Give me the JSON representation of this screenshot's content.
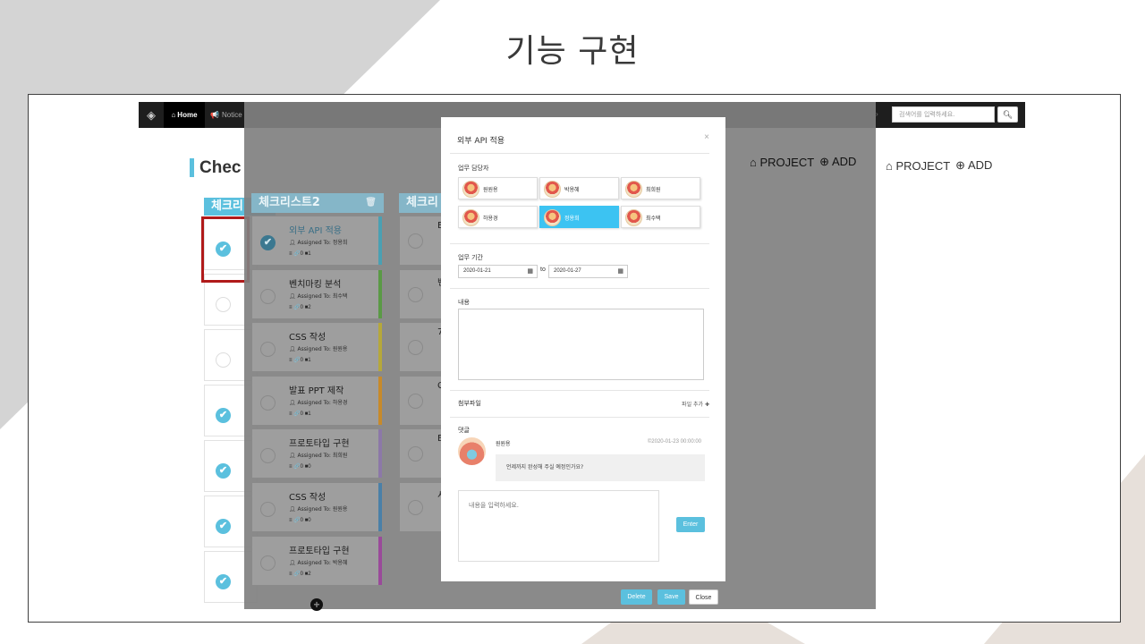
{
  "slide": {
    "title": "기능 구현"
  },
  "nav": {
    "home": "Home",
    "notice": "Notice",
    "search_placeholder": "검색어를 입력하세요."
  },
  "page": {
    "title": "Chec",
    "col1_header": "체크리",
    "project": "PROJECT",
    "add": "ADD",
    "bg_cards": [
      {
        "state": "checked"
      },
      {
        "state": "empty"
      },
      {
        "state": "empty"
      },
      {
        "state": "checked"
      },
      {
        "state": "checked"
      },
      {
        "state": "checked"
      },
      {
        "state": "checked"
      }
    ]
  },
  "board": {
    "col2_header": "체크리스트2",
    "col3_header": "체크리",
    "tasks": [
      {
        "title": "외부 API 적용",
        "assigned": "Assigned To: 정용희",
        "meta": "≡ 🔗0 ■1",
        "done": true,
        "stripe": "#4aa0b3"
      },
      {
        "title": "벤치마킹 분석",
        "assigned": "Assigned To: 최수택",
        "meta": "≡ 🔗0 ■2",
        "done": false,
        "stripe": "#5a9a45"
      },
      {
        "title": "CSS 작성",
        "assigned": "Assigned To: 원원용",
        "meta": "≡ 🔗0 ■1",
        "done": false,
        "stripe": "#b6a83a"
      },
      {
        "title": "발표 PPT 제작",
        "assigned": "Assigned To: 하용경",
        "meta": "≡ 🔗0 ■1",
        "done": false,
        "stripe": "#c78a2a"
      },
      {
        "title": "프로토타입 구현",
        "assigned": "Assigned To: 최희원",
        "meta": "≡ 🔗0 ■0",
        "done": false,
        "stripe": "#8c78a8"
      },
      {
        "title": "CSS 작성",
        "assigned": "Assigned To: 원원용",
        "meta": "≡ 🔗0 ■0",
        "done": false,
        "stripe": "#4a80a8"
      },
      {
        "title": "프로토타입 구현",
        "assigned": "Assigned To: 박용혜",
        "meta": "≡ 🔗0 ■2",
        "done": false,
        "stripe": "#9a4a9a"
      }
    ],
    "col3_letters": [
      "E",
      "벤",
      "7",
      "C",
      "E",
      "서"
    ]
  },
  "modal": {
    "title": "외부 API 적용",
    "assignee_label": "업무 담당자",
    "members": [
      "원원용",
      "박용혜",
      "최희원",
      "하용경",
      "정용희",
      "최수택"
    ],
    "selected_member": "정용희",
    "period_label": "업무 기간",
    "start_date": "2020-01-21",
    "to": "to",
    "end_date": "2020-01-27",
    "content_label": "내용",
    "attach_label": "첨부파일",
    "file_add": "파일 추가",
    "comment_label": "댓글",
    "comment": {
      "author": "원원용",
      "date": "©2020-01-23 00:00:00",
      "text": "언제까지 완성해 주실 예정인가요?"
    },
    "comment_placeholder": "내용을 입력하세요.",
    "enter": "Enter",
    "delete": "Delete",
    "save": "Save",
    "close": "Close"
  }
}
